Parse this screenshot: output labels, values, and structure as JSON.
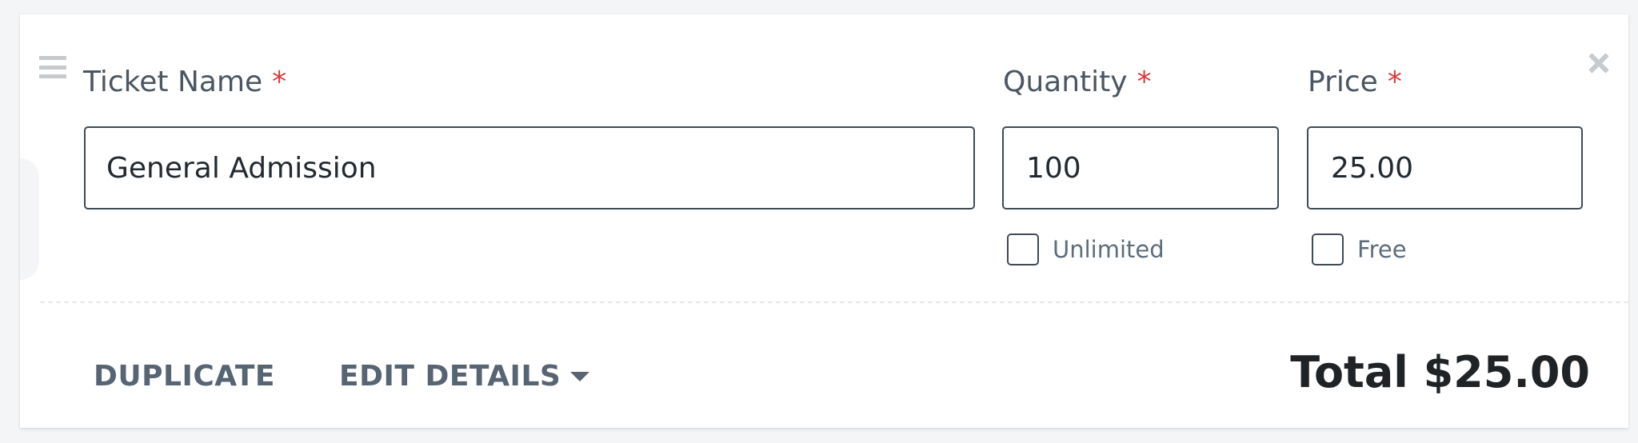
{
  "fields": {
    "ticket_name": {
      "label": "Ticket Name",
      "required_mark": "*",
      "value": "General Admission"
    },
    "quantity": {
      "label": "Quantity",
      "required_mark": "*",
      "value": "100",
      "checkbox_label": "Unlimited"
    },
    "price": {
      "label": "Price",
      "required_mark": "*",
      "value": "25.00",
      "checkbox_label": "Free"
    }
  },
  "actions": {
    "duplicate": "DUPLICATE",
    "edit_details": "EDIT DETAILS"
  },
  "total": "Total $25.00",
  "icons": {
    "drag": "drag-handle-icon",
    "close": "close-icon",
    "caret": "caret-down-icon"
  },
  "colors": {
    "required": "#d93a3a",
    "action_text": "#566473",
    "border": "#3f4a54"
  }
}
